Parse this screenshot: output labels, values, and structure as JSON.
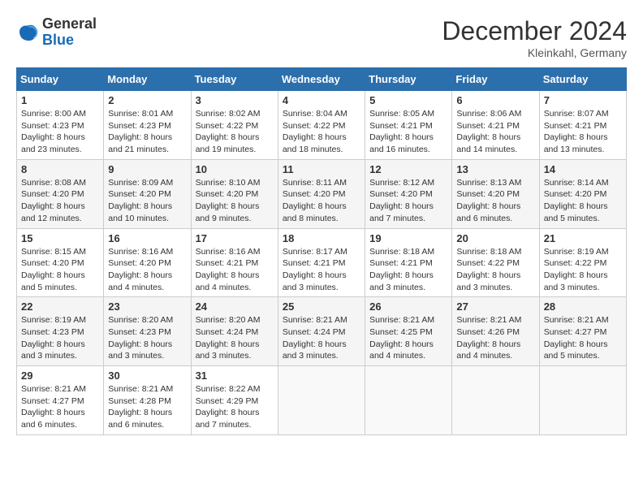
{
  "logo": {
    "general": "General",
    "blue": "Blue"
  },
  "title": "December 2024",
  "location": "Kleinkahl, Germany",
  "headers": [
    "Sunday",
    "Monday",
    "Tuesday",
    "Wednesday",
    "Thursday",
    "Friday",
    "Saturday"
  ],
  "weeks": [
    [
      {
        "day": "1",
        "sunrise": "8:00 AM",
        "sunset": "4:23 PM",
        "daylight": "8 hours and 23 minutes."
      },
      {
        "day": "2",
        "sunrise": "8:01 AM",
        "sunset": "4:23 PM",
        "daylight": "8 hours and 21 minutes."
      },
      {
        "day": "3",
        "sunrise": "8:02 AM",
        "sunset": "4:22 PM",
        "daylight": "8 hours and 19 minutes."
      },
      {
        "day": "4",
        "sunrise": "8:04 AM",
        "sunset": "4:22 PM",
        "daylight": "8 hours and 18 minutes."
      },
      {
        "day": "5",
        "sunrise": "8:05 AM",
        "sunset": "4:21 PM",
        "daylight": "8 hours and 16 minutes."
      },
      {
        "day": "6",
        "sunrise": "8:06 AM",
        "sunset": "4:21 PM",
        "daylight": "8 hours and 14 minutes."
      },
      {
        "day": "7",
        "sunrise": "8:07 AM",
        "sunset": "4:21 PM",
        "daylight": "8 hours and 13 minutes."
      }
    ],
    [
      {
        "day": "8",
        "sunrise": "8:08 AM",
        "sunset": "4:20 PM",
        "daylight": "8 hours and 12 minutes."
      },
      {
        "day": "9",
        "sunrise": "8:09 AM",
        "sunset": "4:20 PM",
        "daylight": "8 hours and 10 minutes."
      },
      {
        "day": "10",
        "sunrise": "8:10 AM",
        "sunset": "4:20 PM",
        "daylight": "8 hours and 9 minutes."
      },
      {
        "day": "11",
        "sunrise": "8:11 AM",
        "sunset": "4:20 PM",
        "daylight": "8 hours and 8 minutes."
      },
      {
        "day": "12",
        "sunrise": "8:12 AM",
        "sunset": "4:20 PM",
        "daylight": "8 hours and 7 minutes."
      },
      {
        "day": "13",
        "sunrise": "8:13 AM",
        "sunset": "4:20 PM",
        "daylight": "8 hours and 6 minutes."
      },
      {
        "day": "14",
        "sunrise": "8:14 AM",
        "sunset": "4:20 PM",
        "daylight": "8 hours and 5 minutes."
      }
    ],
    [
      {
        "day": "15",
        "sunrise": "8:15 AM",
        "sunset": "4:20 PM",
        "daylight": "8 hours and 5 minutes."
      },
      {
        "day": "16",
        "sunrise": "8:16 AM",
        "sunset": "4:20 PM",
        "daylight": "8 hours and 4 minutes."
      },
      {
        "day": "17",
        "sunrise": "8:16 AM",
        "sunset": "4:21 PM",
        "daylight": "8 hours and 4 minutes."
      },
      {
        "day": "18",
        "sunrise": "8:17 AM",
        "sunset": "4:21 PM",
        "daylight": "8 hours and 3 minutes."
      },
      {
        "day": "19",
        "sunrise": "8:18 AM",
        "sunset": "4:21 PM",
        "daylight": "8 hours and 3 minutes."
      },
      {
        "day": "20",
        "sunrise": "8:18 AM",
        "sunset": "4:22 PM",
        "daylight": "8 hours and 3 minutes."
      },
      {
        "day": "21",
        "sunrise": "8:19 AM",
        "sunset": "4:22 PM",
        "daylight": "8 hours and 3 minutes."
      }
    ],
    [
      {
        "day": "22",
        "sunrise": "8:19 AM",
        "sunset": "4:23 PM",
        "daylight": "8 hours and 3 minutes."
      },
      {
        "day": "23",
        "sunrise": "8:20 AM",
        "sunset": "4:23 PM",
        "daylight": "8 hours and 3 minutes."
      },
      {
        "day": "24",
        "sunrise": "8:20 AM",
        "sunset": "4:24 PM",
        "daylight": "8 hours and 3 minutes."
      },
      {
        "day": "25",
        "sunrise": "8:21 AM",
        "sunset": "4:24 PM",
        "daylight": "8 hours and 3 minutes."
      },
      {
        "day": "26",
        "sunrise": "8:21 AM",
        "sunset": "4:25 PM",
        "daylight": "8 hours and 4 minutes."
      },
      {
        "day": "27",
        "sunrise": "8:21 AM",
        "sunset": "4:26 PM",
        "daylight": "8 hours and 4 minutes."
      },
      {
        "day": "28",
        "sunrise": "8:21 AM",
        "sunset": "4:27 PM",
        "daylight": "8 hours and 5 minutes."
      }
    ],
    [
      {
        "day": "29",
        "sunrise": "8:21 AM",
        "sunset": "4:27 PM",
        "daylight": "8 hours and 6 minutes."
      },
      {
        "day": "30",
        "sunrise": "8:21 AM",
        "sunset": "4:28 PM",
        "daylight": "8 hours and 6 minutes."
      },
      {
        "day": "31",
        "sunrise": "8:22 AM",
        "sunset": "4:29 PM",
        "daylight": "8 hours and 7 minutes."
      },
      null,
      null,
      null,
      null
    ]
  ]
}
